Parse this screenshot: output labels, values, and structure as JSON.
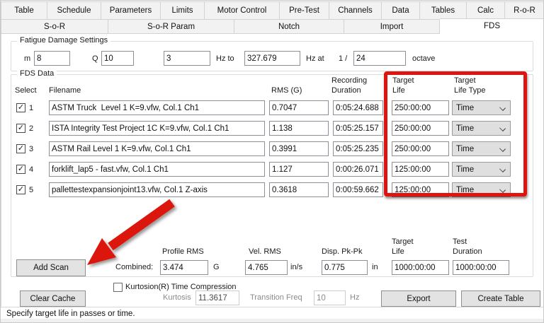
{
  "tabs": {
    "row1": [
      "Table",
      "Schedule",
      "Parameters",
      "Limits",
      "Motor Control",
      "Pre-Test",
      "Channels",
      "Data",
      "Tables",
      "Calc",
      "R-o-R"
    ],
    "row2": [
      "S-o-R",
      "S-o-R Param",
      "Notch",
      "Import",
      "FDS"
    ],
    "active_tab": "FDS"
  },
  "fatigue_settings": {
    "legend": "Fatigue Damage Settings",
    "m_label": "m",
    "m_value": "8",
    "q_label": "Q",
    "q_value": "10",
    "freq_from_value": "3",
    "hz_to_label": "Hz to",
    "hz_to_value": "327.679",
    "hz_at_label": "Hz at",
    "fraction_label": "1 /",
    "octave_fraction_value": "24",
    "octave_label": "octave"
  },
  "fds_data": {
    "legend": "FDS Data",
    "headers": {
      "select": "Select",
      "filename": "Filename",
      "rms": "RMS (G)",
      "recording_line1": "Recording",
      "recording_line2": "Duration",
      "target_life_line1": "Target",
      "target_life_line2": "Life",
      "target_type_line1": "Target",
      "target_type_line2": "Life Type"
    },
    "rows": [
      {
        "num": "1",
        "checked": true,
        "filename": "ASTM Truck  Level 1 K=9.vfw, Col.1 Ch1",
        "rms": "0.7047",
        "duration": "0:05:24.688",
        "target_life": "250:00:00",
        "life_type": "Time"
      },
      {
        "num": "2",
        "checked": true,
        "filename": "ISTA Integrity Test Project 1C K=9.vfw, Col.1 Ch1",
        "rms": "1.138",
        "duration": "0:05:25.157",
        "target_life": "250:00:00",
        "life_type": "Time"
      },
      {
        "num": "3",
        "checked": true,
        "filename": "ASTM Rail Level 1 K=9.vfw, Col.1 Ch1",
        "rms": "0.3991",
        "duration": "0:05:25.235",
        "target_life": "250:00:00",
        "life_type": "Time"
      },
      {
        "num": "4",
        "checked": true,
        "filename": "forklift_lap5 - fast.vfw, Col.1 Ch1",
        "rms": "1.127",
        "duration": "0:00:26.071",
        "target_life": "125:00:00",
        "life_type": "Time"
      },
      {
        "num": "5",
        "checked": true,
        "filename": "pallettestexpansionjoint13.vfw, Col.1 Z-axis",
        "rms": "0.3618",
        "duration": "0:00:59.662",
        "target_life": "125:00:00",
        "life_type": "Time"
      }
    ],
    "summary": {
      "add_scan_label": "Add Scan",
      "profile_rms_label": "Profile RMS",
      "combined_label": "Combined:",
      "combined_value": "3.474",
      "combined_unit": "G",
      "vel_rms_label": "Vel. RMS",
      "vel_rms_value": "4.765",
      "vel_rms_unit": "in/s",
      "disp_label": "Disp. Pk-Pk",
      "disp_value": "0.775",
      "disp_unit": "in",
      "target_life_label_line1": "Target",
      "target_life_label_line2": "Life",
      "target_life_value": "1000:00:00",
      "test_duration_label_line1": "Test",
      "test_duration_label_line2": "Duration",
      "test_duration_value": "1000:00:00"
    }
  },
  "bottom_controls": {
    "clear_cache_label": "Clear Cache",
    "kurtosion_checkbox_label": "Kurtosion(R) Time Compression",
    "kurtosion_checked": false,
    "kurtosis_label": "Kurtosis",
    "kurtosis_value": "11.3617",
    "transition_freq_label": "Transition Freq",
    "transition_freq_value": "10",
    "hz_label": "Hz",
    "export_label": "Export",
    "create_table_label": "Create Table"
  },
  "status_text": "Specify target life in passes or time.",
  "annotations": {
    "highlight_color": "#dd1410",
    "highlight_target": "target-life-columns",
    "arrow_target": "add-scan-button",
    "checkmark": "✓"
  }
}
